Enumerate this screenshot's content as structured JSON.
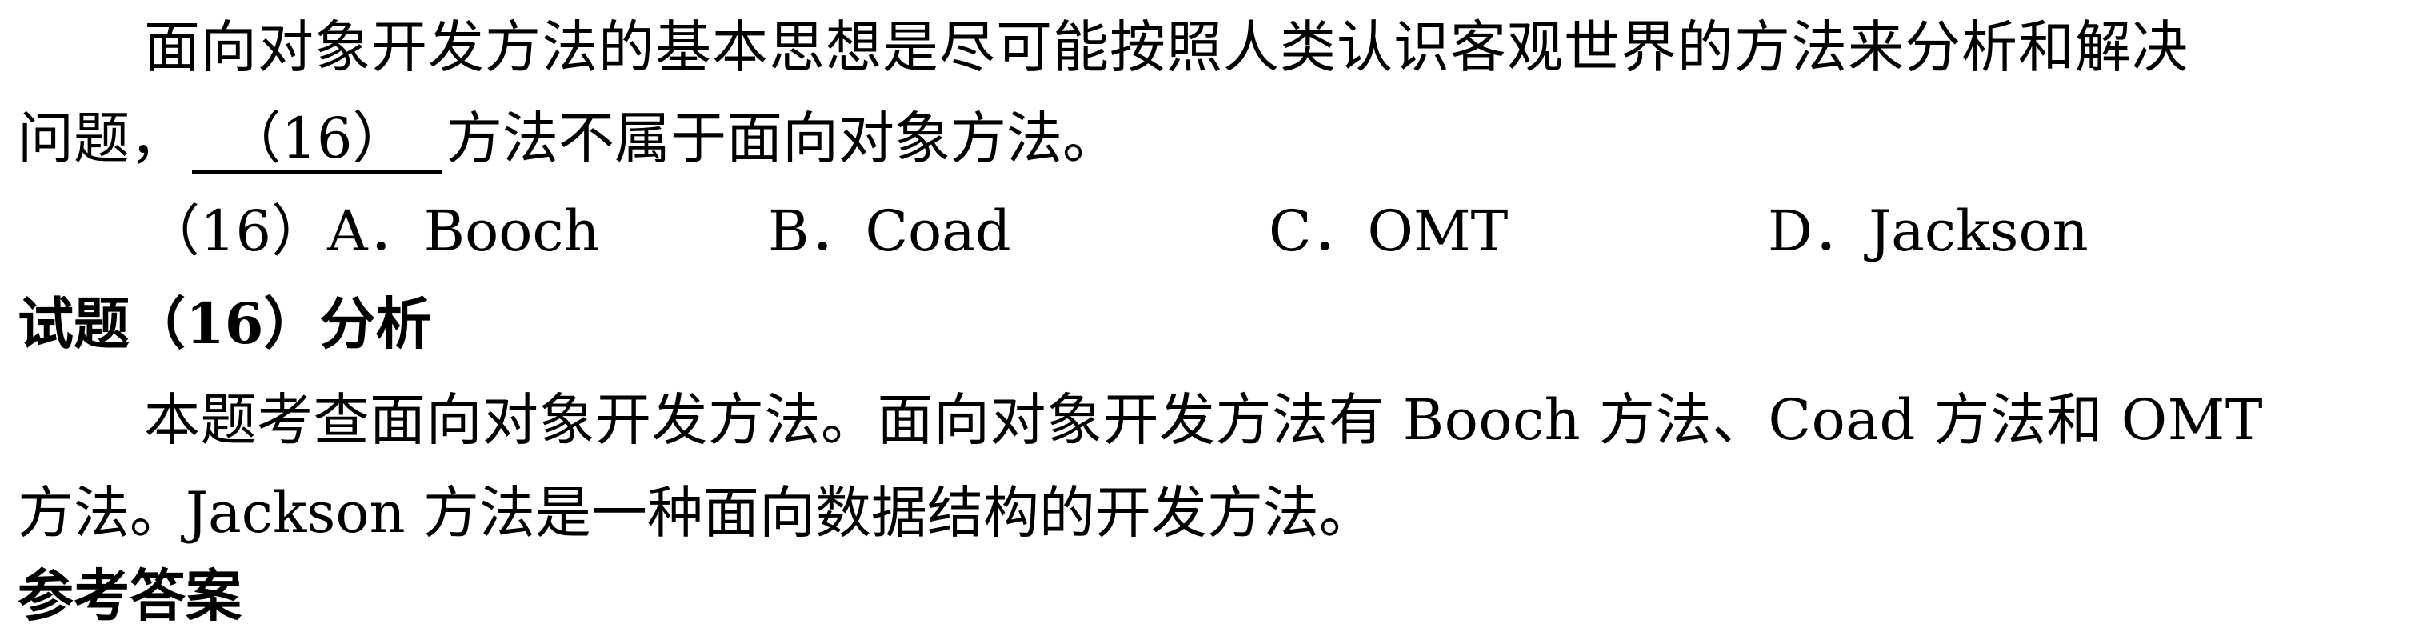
{
  "question": {
    "stem_line1": "面向对象开发方法的基本思想是尽可能按照人类认识客观世界的方法来分析和解决",
    "stem_line2_prefix": "问题，",
    "blank_label": "（16）",
    "stem_line2_suffix": "方法不属于面向对象方法。",
    "options": {
      "a": "（16）A．Booch",
      "b": "B．Coad",
      "c": "C．OMT",
      "d": "D．Jackson"
    }
  },
  "analysis": {
    "heading": "试题（16）分析",
    "line1": "本题考查面向对象开发方法。面向对象开发方法有 Booch 方法、Coad 方法和 OMT",
    "line2": "方法。Jackson 方法是一种面向数据结构的开发方法。"
  },
  "next_heading_partial": "参考答案"
}
